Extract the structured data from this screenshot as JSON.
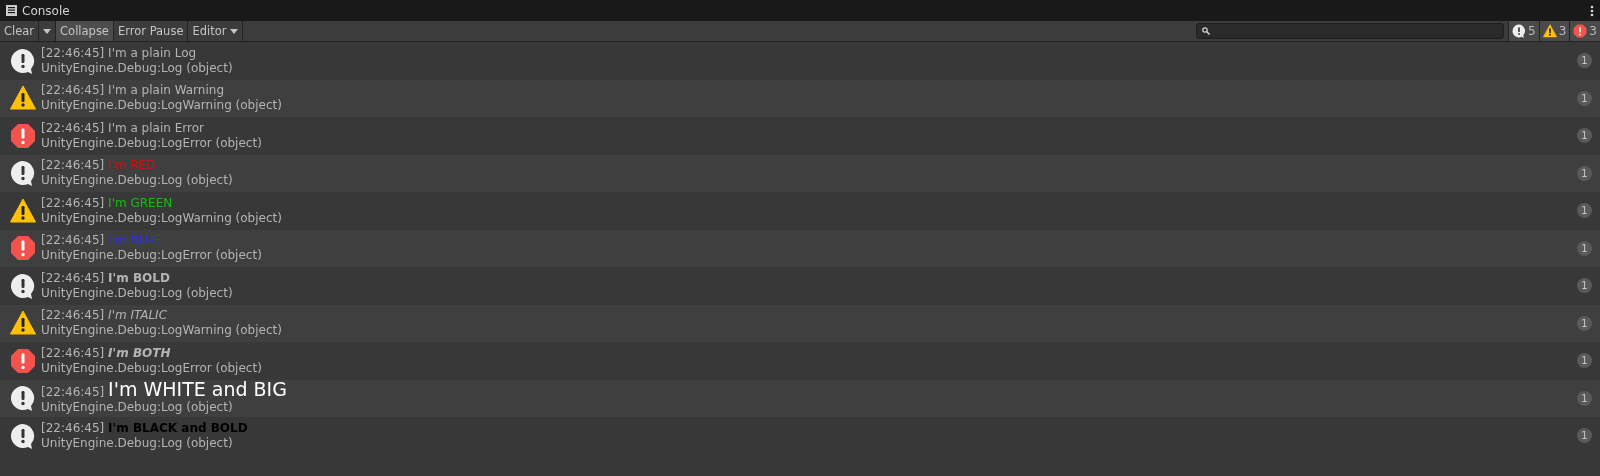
{
  "window": {
    "title": "Console"
  },
  "toolbar": {
    "buttons": [
      {
        "kind": "button",
        "label": "Clear",
        "on": false
      },
      {
        "kind": "caret",
        "on": false
      },
      {
        "kind": "toggle",
        "label": "Collapse",
        "on": true
      },
      {
        "kind": "toggle",
        "label": "Error Pause",
        "on": false
      },
      {
        "kind": "dropdown",
        "label": "Editor",
        "on": false
      }
    ],
    "counters": [
      {
        "kind": "log",
        "count": "5"
      },
      {
        "kind": "warning",
        "count": "3"
      },
      {
        "kind": "error",
        "count": "3"
      }
    ]
  },
  "entries": [
    {
      "kind": "log",
      "timestamp": "[22:46:45]",
      "message": "I'm a plain Log",
      "trace": "UnityEngine.Debug:Log (object)",
      "count": "1"
    },
    {
      "kind": "warning",
      "timestamp": "[22:46:45]",
      "message": "I'm a plain Warning",
      "trace": "UnityEngine.Debug:LogWarning (object)",
      "count": "1"
    },
    {
      "kind": "error",
      "timestamp": "[22:46:45]",
      "message": "I'm a plain Error",
      "trace": "UnityEngine.Debug:LogError (object)",
      "count": "1"
    },
    {
      "kind": "log",
      "timestamp": "[22:46:45]",
      "message": "I'm RED",
      "color": "#d01010",
      "trace": "UnityEngine.Debug:Log (object)",
      "count": "1"
    },
    {
      "kind": "warning",
      "timestamp": "[22:46:45]",
      "message": "I'm GREEN",
      "color": "#10c010",
      "trace": "UnityEngine.Debug:LogWarning (object)",
      "count": "1"
    },
    {
      "kind": "error",
      "timestamp": "[22:46:45]",
      "message": "I'm BLUE",
      "color": "#3030ee",
      "trace": "UnityEngine.Debug:LogError (object)",
      "count": "1"
    },
    {
      "kind": "log",
      "timestamp": "[22:46:45]",
      "message": "I'm BOLD",
      "bold": true,
      "trace": "UnityEngine.Debug:Log (object)",
      "count": "1"
    },
    {
      "kind": "warning",
      "timestamp": "[22:46:45]",
      "message": "I'm ITALIC",
      "italic": true,
      "trace": "UnityEngine.Debug:LogWarning (object)",
      "count": "1"
    },
    {
      "kind": "error",
      "timestamp": "[22:46:45]",
      "message": "I'm BOTH",
      "bold": true,
      "italic": true,
      "trace": "UnityEngine.Debug:LogError (object)",
      "count": "1"
    },
    {
      "kind": "log",
      "timestamp": "[22:46:45]",
      "message": "I'm WHITE and BIG",
      "large": true,
      "color": "#ffffff",
      "trace": "UnityEngine.Debug:Log (object)",
      "count": "1"
    },
    {
      "kind": "log",
      "timestamp": "[22:46:45]",
      "message": "I'm BLACK and BOLD",
      "bold": true,
      "color": "#000000",
      "trace": "UnityEngine.Debug:Log (object)",
      "count": "1"
    }
  ]
}
